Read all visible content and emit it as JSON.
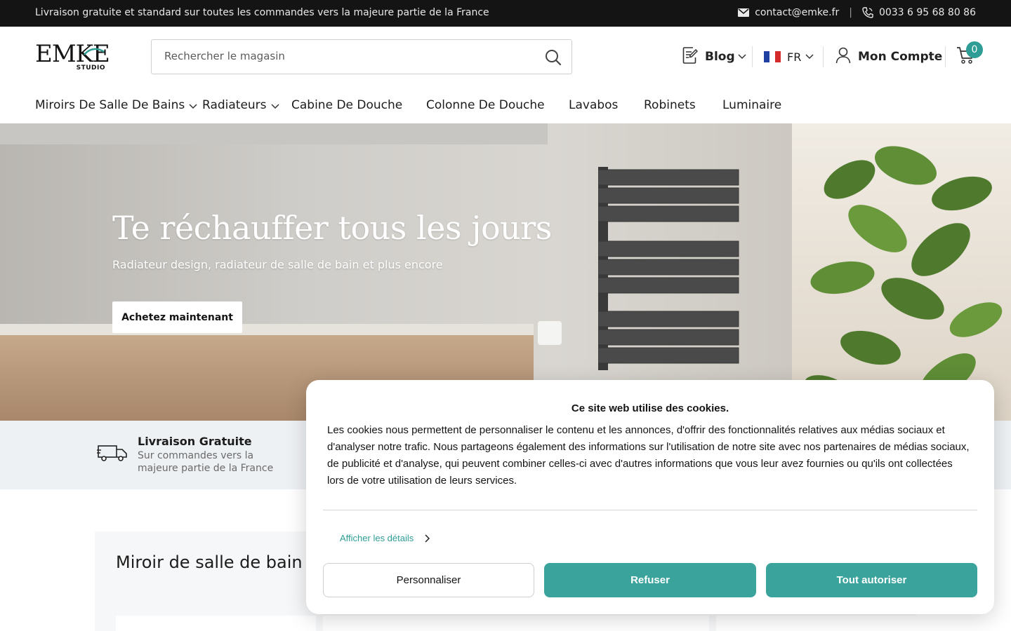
{
  "topbar": {
    "announcement": "Livraison gratuite et standard sur toutes les commandes vers la majeure partie de la France",
    "email": "contact@emke.fr",
    "separator": "|",
    "phone": "0033 6 95 68 80 86"
  },
  "header": {
    "logo_word": "EMKE",
    "logo_sub": "STUDIO",
    "search_placeholder": "Rechercher le magasin",
    "blog_label": "Blog",
    "lang_label": "FR",
    "account_label": "Mon Compte",
    "cart_count": "0"
  },
  "nav": {
    "items": [
      {
        "label": "Miroirs De Salle De Bains",
        "has_dropdown": true
      },
      {
        "label": "Radiateurs",
        "has_dropdown": true
      },
      {
        "label": "Cabine De Douche",
        "has_dropdown": false
      },
      {
        "label": "Colonne De Douche",
        "has_dropdown": false
      },
      {
        "label": "Lavabos",
        "has_dropdown": false
      },
      {
        "label": "Robinets",
        "has_dropdown": false
      },
      {
        "label": "Luminaire",
        "has_dropdown": false
      }
    ]
  },
  "hero": {
    "title": "Te réchauffer tous les jours",
    "subtitle": "Radiateur design, radiateur de salle de bain et plus encore",
    "cta": "Achetez maintenant"
  },
  "features": {
    "delivery_title": "Livraison Gratuite",
    "delivery_line1": "Sur commandes vers la",
    "delivery_line2": "majeure partie de la France"
  },
  "section": {
    "heading": "Miroir de salle de bain"
  },
  "cookie": {
    "title": "Ce site web utilise des cookies.",
    "body": "Les cookies nous permettent de personnaliser le contenu et les annonces, d'offrir des fonctionnalités relatives aux médias sociaux et d'analyser notre trafic. Nous partageons également des informations sur l'utilisation de notre site avec nos partenaires de médias sociaux, de publicité et d'analyse, qui peuvent combiner celles-ci avec d'autres informations que vous leur avez fournies ou qu'ils ont collectées lors de votre utilisation de leurs services.",
    "details_label": "Afficher les détails",
    "btn_customize": "Personnaliser",
    "btn_refuse": "Refuser",
    "btn_accept": "Tout autoriser"
  },
  "colors": {
    "accent": "#3aa39c",
    "topbar_bg": "#141414",
    "feature_bg": "#eef1f4"
  },
  "icons": {
    "email": "mail-icon",
    "phone": "phone-icon",
    "search": "search-icon",
    "blog": "document-edit-icon",
    "account": "user-icon",
    "cart": "cart-icon",
    "delivery": "truck-icon"
  }
}
